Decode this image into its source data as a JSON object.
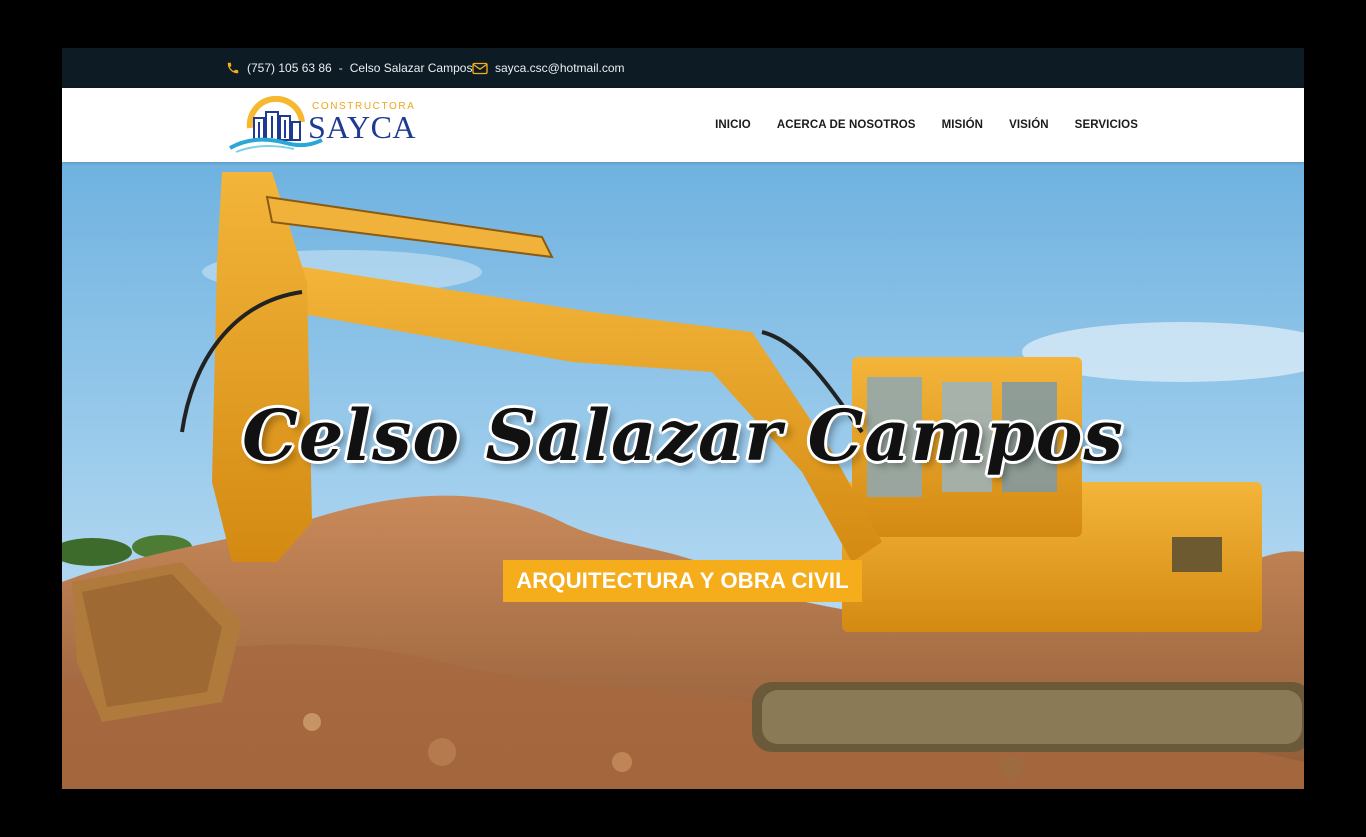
{
  "topbar": {
    "phone": "(757) 105 63 86",
    "separator": "-",
    "contact_name": "Celso Salazar Campos",
    "email": "sayca.csc@hotmail.com",
    "icon_color": "#f5ad1b"
  },
  "logo": {
    "small_text": "CONSTRUCTORA",
    "brand": "SAYCA",
    "accent": "#f0a51c",
    "brand_color": "#1f3a93",
    "wave_color": "#2aa7d6"
  },
  "nav": {
    "items": [
      "INICIO",
      "ACERCA DE NOSOTROS",
      "MISIÓN",
      "VISIÓN",
      "SERVICIOS"
    ]
  },
  "hero": {
    "title": "Celso Salazar Campos",
    "badge": "ARQUITECTURA Y OBRA CIVIL",
    "badge_color": "#f5ad1b",
    "image": "excavator-on-dirt-image"
  }
}
